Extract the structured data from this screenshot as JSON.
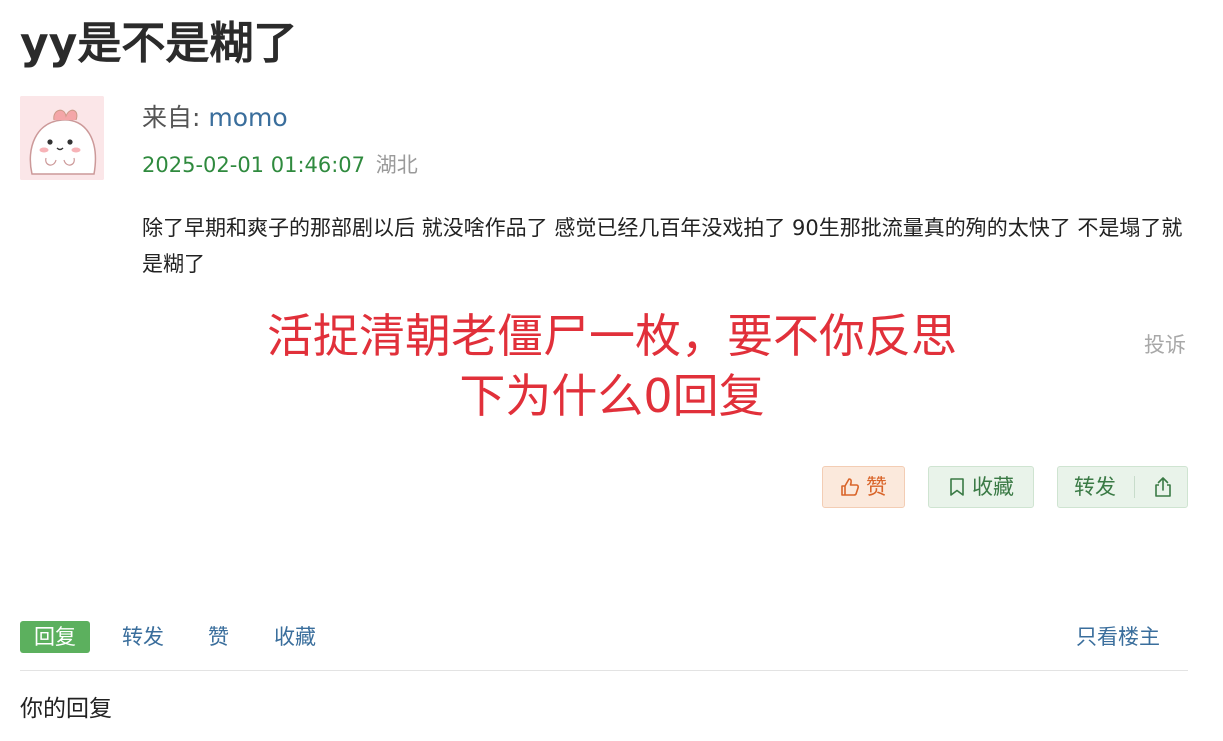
{
  "post": {
    "title": "yy是不是糊了",
    "from_label": "来自: ",
    "author": "momo",
    "timestamp": "2025-02-01 01:46:07",
    "location": "湖北",
    "body": "除了早期和爽子的那部剧以后 就没啥作品了 感觉已经几百年没戏拍了 90生那批流量真的殉的太快了 不是塌了就是糊了",
    "report_label": "投诉"
  },
  "overlay": {
    "line1": "活捉清朝老僵尸一枚，要不你反思",
    "line2": "下为什么0回复"
  },
  "actions": {
    "like_label": "赞",
    "favorite_label": "收藏",
    "forward_label": "转发"
  },
  "reply_bar": {
    "reply_tab": "回复",
    "forward_tab": "转发",
    "like_tab": "赞",
    "favorite_tab": "收藏",
    "only_op": "只看楼主"
  },
  "your_reply_label": "你的回复",
  "colors": {
    "link_blue": "#3a6e9c",
    "time_green": "#2f8a3e",
    "overlay_red": "#e1303a",
    "reply_active_green": "#5cb05e"
  }
}
